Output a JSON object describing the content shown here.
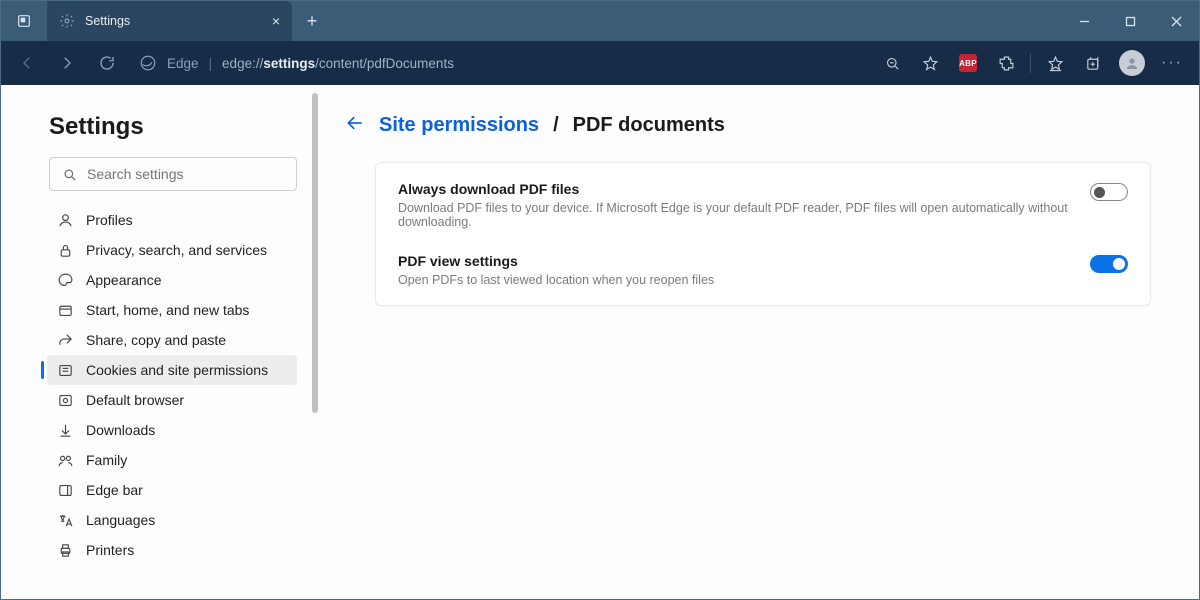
{
  "titlebar": {
    "tab_title": "Settings"
  },
  "toolbar": {
    "edge_label": "Edge",
    "url_prefix": "edge://",
    "url_bold": "settings",
    "url_suffix": "/content/pdfDocuments",
    "abp_label": "ABP"
  },
  "sidebar": {
    "title": "Settings",
    "search_placeholder": "Search settings",
    "items": [
      {
        "label": "Profiles"
      },
      {
        "label": "Privacy, search, and services"
      },
      {
        "label": "Appearance"
      },
      {
        "label": "Start, home, and new tabs"
      },
      {
        "label": "Share, copy and paste"
      },
      {
        "label": "Cookies and site permissions"
      },
      {
        "label": "Default browser"
      },
      {
        "label": "Downloads"
      },
      {
        "label": "Family"
      },
      {
        "label": "Edge bar"
      },
      {
        "label": "Languages"
      },
      {
        "label": "Printers"
      }
    ]
  },
  "main": {
    "breadcrumb_parent": "Site permissions",
    "breadcrumb_current": "PDF documents",
    "rows": [
      {
        "title": "Always download PDF files",
        "desc": "Download PDF files to your device. If Microsoft Edge is your default PDF reader, PDF files will open automatically without downloading.",
        "on": false
      },
      {
        "title": "PDF view settings",
        "desc": "Open PDFs to last viewed location when you reopen files",
        "on": true
      }
    ]
  }
}
